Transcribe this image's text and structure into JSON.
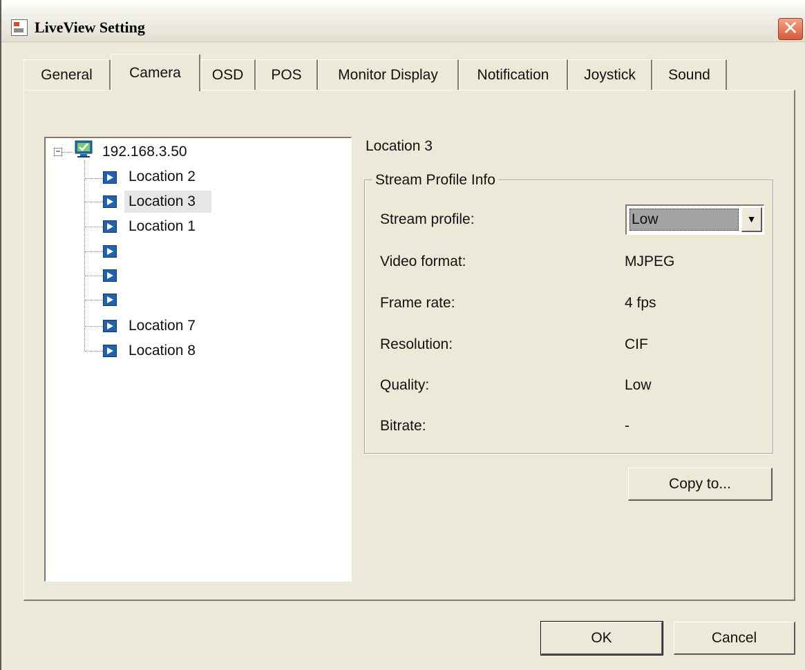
{
  "window": {
    "title": "LiveView Setting",
    "close_glyph": "✕"
  },
  "tabs": [
    {
      "label": "General"
    },
    {
      "label": "Camera"
    },
    {
      "label": "OSD"
    },
    {
      "label": "POS"
    },
    {
      "label": "Monitor Display"
    },
    {
      "label": "Notification"
    },
    {
      "label": "Joystick"
    },
    {
      "label": "Sound"
    }
  ],
  "active_tab": "Camera",
  "tree": {
    "expander_glyph": "−",
    "root": {
      "label": "192.168.3.50",
      "icon": "monitor-icon"
    },
    "items": [
      {
        "label": "Location 2",
        "icon": "camera-icon"
      },
      {
        "label": "Location 3",
        "icon": "camera-icon",
        "selected": true
      },
      {
        "label": "Location 1",
        "icon": "camera-icon"
      },
      {
        "label": "",
        "icon": "camera-icon"
      },
      {
        "label": "",
        "icon": "camera-icon"
      },
      {
        "label": "",
        "icon": "camera-icon"
      },
      {
        "label": "Location 7",
        "icon": "camera-icon"
      },
      {
        "label": "Location 8",
        "icon": "camera-icon"
      }
    ]
  },
  "details": {
    "location_title": "Location 3",
    "group_title": "Stream Profile Info",
    "stream_profile": {
      "label": "Stream profile:",
      "value": "Low",
      "arrow_glyph": "▼"
    },
    "fields": [
      {
        "label": "Video format:",
        "value": "MJPEG"
      },
      {
        "label": "Frame rate:",
        "value": "4 fps"
      },
      {
        "label": "Resolution:",
        "value": "CIF"
      },
      {
        "label": "Quality:",
        "value": "Low"
      },
      {
        "label": "Bitrate:",
        "value": "-"
      }
    ],
    "copy_button": "Copy to..."
  },
  "footer": {
    "ok_label": "OK",
    "cancel_label": "Cancel"
  }
}
